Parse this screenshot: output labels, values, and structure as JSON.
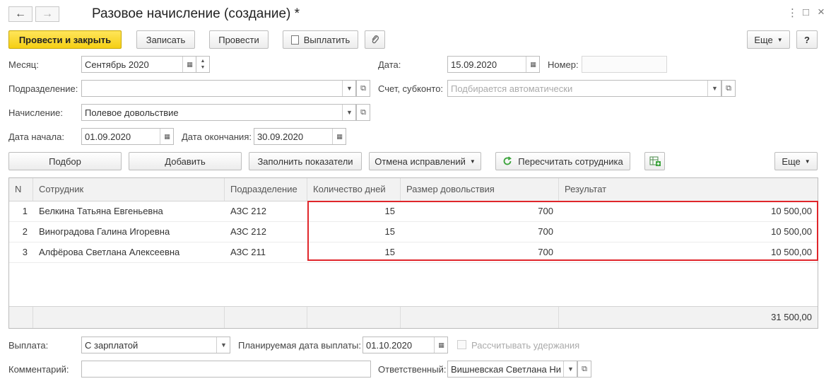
{
  "header": {
    "title": "Разовое начисление (создание) *",
    "back_icon": "←",
    "forward_icon": "→",
    "more_icon": "⋮",
    "maximize_icon": "□",
    "close_icon": "×"
  },
  "toolbar": {
    "post_close": "Провести и закрыть",
    "save": "Записать",
    "post": "Провести",
    "pay": "Выплатить",
    "more": "Еще",
    "help": "?"
  },
  "form": {
    "month_label": "Месяц:",
    "month_value": "Сентябрь 2020",
    "date_label": "Дата:",
    "date_value": "15.09.2020",
    "number_label": "Номер:",
    "number_value": "",
    "department_label": "Подразделение:",
    "department_value": "",
    "account_label": "Счет, субконто:",
    "account_placeholder": "Подбирается автоматически",
    "accrual_label": "Начисление:",
    "accrual_value": "Полевое довольствие",
    "start_label": "Дата начала:",
    "start_value": "01.09.2020",
    "end_label": "Дата окончания:",
    "end_value": "30.09.2020"
  },
  "table_toolbar": {
    "pick": "Подбор",
    "add": "Добавить",
    "fill": "Заполнить показатели",
    "cancel_fix": "Отмена исправлений",
    "recalc": "Пересчитать сотрудника",
    "more": "Еще"
  },
  "table": {
    "columns": [
      "N",
      "Сотрудник",
      "Подразделение",
      "Количество дней",
      "Размер довольствия",
      "Результат"
    ],
    "rows": [
      {
        "n": "1",
        "employee": "Белкина Татьяна Евгеньевна",
        "dept": "АЗС 212",
        "days": "15",
        "amount": "700",
        "result": "10 500,00"
      },
      {
        "n": "2",
        "employee": "Виноградова Галина Игоревна",
        "dept": "АЗС 212",
        "days": "15",
        "amount": "700",
        "result": "10 500,00"
      },
      {
        "n": "3",
        "employee": "Алфёрова Светлана Алексеевна",
        "dept": "АЗС 211",
        "days": "15",
        "amount": "700",
        "result": "10 500,00"
      }
    ],
    "total": "31 500,00"
  },
  "footer": {
    "payment_label": "Выплата:",
    "payment_value": "С зарплатой",
    "planned_label": "Планируемая дата выплаты:",
    "planned_value": "01.10.2020",
    "calc_deductions": "Рассчитывать удержания",
    "comment_label": "Комментарий:",
    "comment_value": "",
    "responsible_label": "Ответственный:",
    "responsible_value": "Вишневская Светлана Ни"
  },
  "colors": {
    "primary": "#f5cf14",
    "highlight": "#e0262b",
    "refresh_icon": "#3aa33a"
  }
}
